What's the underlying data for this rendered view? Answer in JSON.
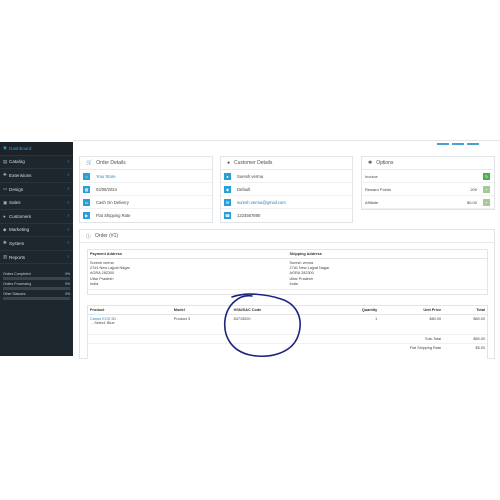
{
  "sidebar": {
    "items": [
      {
        "label": "Dashboard",
        "icon": "dashboard-icon",
        "glyph": "◉",
        "active": true
      },
      {
        "label": "Catalog",
        "icon": "tag-icon",
        "glyph": "▤",
        "active": false
      },
      {
        "label": "Extensions",
        "icon": "puzzle-icon",
        "glyph": "✚",
        "active": false
      },
      {
        "label": "Design",
        "icon": "monitor-icon",
        "glyph": "▭",
        "active": false
      },
      {
        "label": "Sales",
        "icon": "cart-icon",
        "glyph": "▣",
        "active": false
      },
      {
        "label": "Customers",
        "icon": "user-icon",
        "glyph": "●",
        "active": false
      },
      {
        "label": "Marketing",
        "icon": "share-icon",
        "glyph": "◆",
        "active": false
      },
      {
        "label": "System",
        "icon": "cog-icon",
        "glyph": "✱",
        "active": false
      },
      {
        "label": "Reports",
        "icon": "chart-icon",
        "glyph": "▥",
        "active": false
      }
    ],
    "stats": [
      {
        "label": "Orders Completed",
        "value": "0%",
        "fraction": 0.0
      },
      {
        "label": "Orders Processing",
        "value": "0%",
        "fraction": 0.0
      },
      {
        "label": "Other Statuses",
        "value": "0%",
        "fraction": 0.0
      }
    ]
  },
  "order_details": {
    "title": "Order Details",
    "store": "Your Store",
    "date": "02/08/2024",
    "payment": "Cash On Delivery",
    "shipping": "Flat Shipping Rate"
  },
  "customer_details": {
    "title": "Customer Details",
    "name": "Suresh verma",
    "group": "Default",
    "email": "suresh.verma@gmail.com",
    "phone": "1234567890"
  },
  "options": {
    "title": "Options",
    "rows": [
      {
        "label": "Invoice",
        "value": ""
      },
      {
        "label": "Reward Points",
        "value": "200"
      },
      {
        "label": "Affiliate",
        "value": "$0.00"
      }
    ]
  },
  "order": {
    "title": "Order (#1)",
    "payment_address_header": "Payment Address",
    "shipping_address_header": "Shipping Address",
    "payment_address": [
      "Suresh verma",
      "27d1 New Lajpat Nagar",
      "AGRA 282300",
      "Uttar Pradesh",
      "India"
    ],
    "shipping_address": [
      "Suresh verma",
      "27d1 New Lajpat Nagar",
      "AGRA 282300",
      "Uttar Pradesh",
      "India"
    ],
    "columns": {
      "product": "Product",
      "model": "Model",
      "hsn": "HSN/SAC Code",
      "quantity": "Quantity",
      "unit_price": "Unit Price",
      "total": "Total"
    },
    "item": {
      "product": "Canon EOS 5D",
      "option": "- Select: Blue",
      "model": "Product 3",
      "hsn": "84715000",
      "quantity": "1",
      "unit_price": "$80.00",
      "total": "$80.00"
    },
    "totals": [
      {
        "label": "Sub-Total",
        "value": "$80.00"
      },
      {
        "label": "Flat Shipping Rate",
        "value": "$5.00"
      }
    ]
  },
  "colors": {
    "accent": "#2a9fd6",
    "sidebar": "#1e272e",
    "annotation": "#1a237e"
  }
}
